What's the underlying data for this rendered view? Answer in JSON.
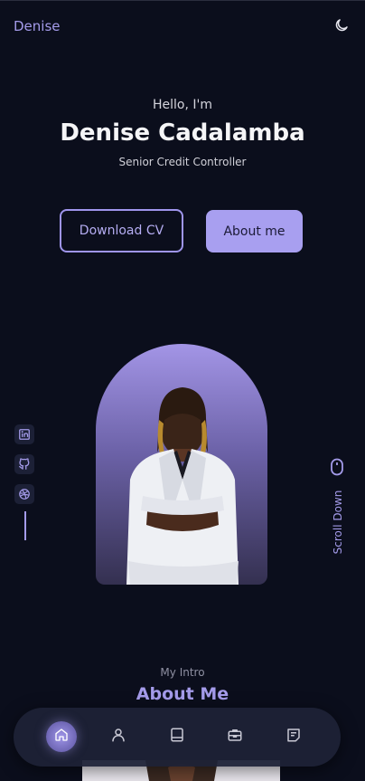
{
  "header": {
    "brand": "Denise",
    "theme_icon": "moon-icon"
  },
  "hero": {
    "greeting": "Hello, I'm",
    "name": "Denise Cadalamba",
    "role": "Senior Credit Controller",
    "download_label": "Download CV",
    "about_label": "About me"
  },
  "socials": [
    "linkedin-icon",
    "github-icon",
    "dribbble-icon"
  ],
  "scroll": {
    "label": "Scroll Down",
    "icon": "mouse-icon"
  },
  "intro": {
    "kicker": "My Intro",
    "title": "About Me"
  },
  "nav": {
    "items": [
      "home-icon",
      "user-icon",
      "book-icon",
      "briefcase-icon",
      "message-icon"
    ],
    "active": "home-icon"
  },
  "colors": {
    "accent": "#a49bea",
    "background": "#0b0e1c",
    "button_fill": "#a89ff0"
  }
}
